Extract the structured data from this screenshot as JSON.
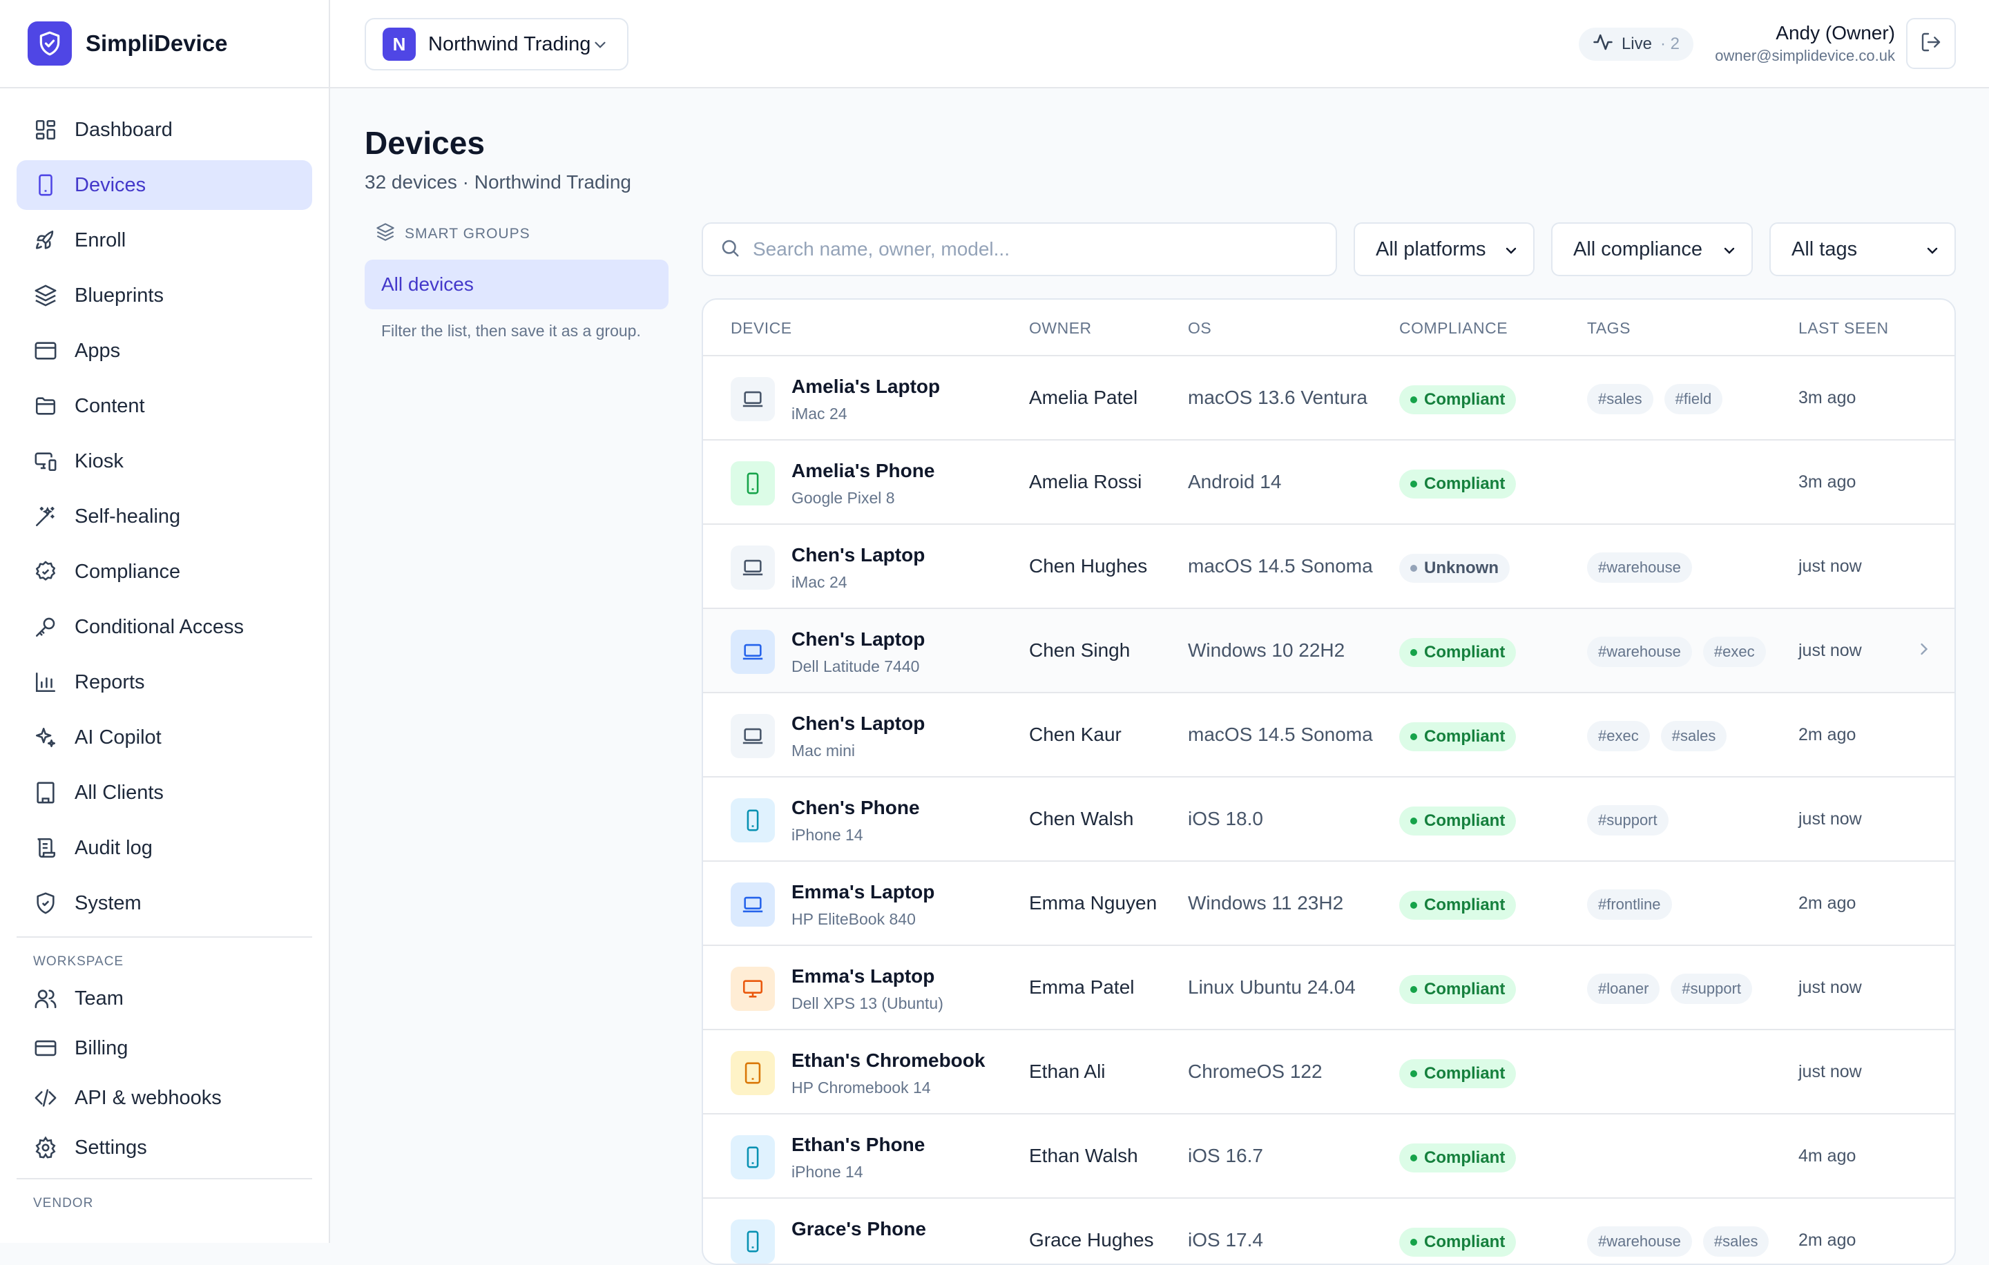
{
  "app": {
    "name": "SimpliDevice",
    "tenant": {
      "initial": "N",
      "name": "Northwind Trading"
    },
    "live": {
      "label": "Live",
      "count": "· 2"
    },
    "user": {
      "name": "Andy (Owner)",
      "email": "owner@simplidevice.co.uk"
    }
  },
  "sidebar": {
    "items": [
      {
        "label": "Dashboard"
      },
      {
        "label": "Devices"
      },
      {
        "label": "Enroll"
      },
      {
        "label": "Blueprints"
      },
      {
        "label": "Apps"
      },
      {
        "label": "Content"
      },
      {
        "label": "Kiosk"
      },
      {
        "label": "Self-healing"
      },
      {
        "label": "Compliance"
      },
      {
        "label": "Conditional Access"
      },
      {
        "label": "Reports"
      },
      {
        "label": "AI Copilot"
      },
      {
        "label": "All Clients"
      },
      {
        "label": "Audit log"
      },
      {
        "label": "System"
      }
    ],
    "workspace_label": "WORKSPACE",
    "workspace": [
      {
        "label": "Team"
      },
      {
        "label": "Billing"
      },
      {
        "label": "API & webhooks"
      },
      {
        "label": "Settings"
      }
    ],
    "vendor_label": "VENDOR"
  },
  "page": {
    "title": "Devices",
    "subtitle": "32 devices · Northwind Trading"
  },
  "groups": {
    "heading": "SMART GROUPS",
    "item": "All devices",
    "hint": "Filter the list, then save it as a group."
  },
  "filters": {
    "search_placeholder": "Search name, owner, model...",
    "platform": "All platforms",
    "compliance": "All compliance",
    "tags": "All tags"
  },
  "table": {
    "columns": [
      "DEVICE",
      "OWNER",
      "OS",
      "COMPLIANCE",
      "TAGS",
      "LAST SEEN"
    ],
    "rows": [
      {
        "name": "Amelia's Laptop",
        "model": "iMac 24",
        "owner": "Amelia Patel",
        "os": "macOS 13.6 Ventura",
        "compliance": "Compliant",
        "tags": [
          "#sales",
          "#field"
        ],
        "seen": "3m ago",
        "icon": "laptop-icon",
        "color": "#475569",
        "bg": "#f1f5f9"
      },
      {
        "name": "Amelia's Phone",
        "model": "Google Pixel 8",
        "owner": "Amelia Rossi",
        "os": "Android 14",
        "compliance": "Compliant",
        "tags": [],
        "seen": "3m ago",
        "icon": "phone-icon",
        "color": "#16a34a",
        "bg": "#dcfce7"
      },
      {
        "name": "Chen's Laptop",
        "model": "iMac 24",
        "owner": "Chen Hughes",
        "os": "macOS 14.5 Sonoma",
        "compliance": "Unknown",
        "tags": [
          "#warehouse"
        ],
        "seen": "just now",
        "icon": "laptop-icon",
        "color": "#475569",
        "bg": "#f1f5f9"
      },
      {
        "name": "Chen's Laptop",
        "model": "Dell Latitude 7440",
        "owner": "Chen Singh",
        "os": "Windows 10 22H2",
        "compliance": "Compliant",
        "tags": [
          "#warehouse",
          "#exec"
        ],
        "seen": "just now",
        "icon": "laptop-icon",
        "color": "#2563eb",
        "bg": "#dbeafe"
      },
      {
        "name": "Chen's Laptop",
        "model": "Mac mini",
        "owner": "Chen Kaur",
        "os": "macOS 14.5 Sonoma",
        "compliance": "Compliant",
        "tags": [
          "#exec",
          "#sales"
        ],
        "seen": "2m ago",
        "icon": "laptop-icon",
        "color": "#475569",
        "bg": "#f1f5f9"
      },
      {
        "name": "Chen's Phone",
        "model": "iPhone 14",
        "owner": "Chen Walsh",
        "os": "iOS 18.0",
        "compliance": "Compliant",
        "tags": [
          "#support"
        ],
        "seen": "just now",
        "icon": "phone-icon",
        "color": "#0891b2",
        "bg": "#e0f2fe"
      },
      {
        "name": "Emma's Laptop",
        "model": "HP EliteBook 840",
        "owner": "Emma Nguyen",
        "os": "Windows 11 23H2",
        "compliance": "Compliant",
        "tags": [
          "#frontline"
        ],
        "seen": "2m ago",
        "icon": "laptop-icon",
        "color": "#2563eb",
        "bg": "#dbeafe"
      },
      {
        "name": "Emma's Laptop",
        "model": "Dell XPS 13 (Ubuntu)",
        "owner": "Emma Patel",
        "os": "Linux Ubuntu 24.04",
        "compliance": "Compliant",
        "tags": [
          "#loaner",
          "#support"
        ],
        "seen": "just now",
        "icon": "monitor-icon",
        "color": "#ea580c",
        "bg": "#ffedd5"
      },
      {
        "name": "Ethan's Chromebook",
        "model": "HP Chromebook 14",
        "owner": "Ethan Ali",
        "os": "ChromeOS 122",
        "compliance": "Compliant",
        "tags": [],
        "seen": "just now",
        "icon": "tablet-icon",
        "color": "#d97706",
        "bg": "#fef3c7"
      },
      {
        "name": "Ethan's Phone",
        "model": "iPhone 14",
        "owner": "Ethan Walsh",
        "os": "iOS 16.7",
        "compliance": "Compliant",
        "tags": [],
        "seen": "4m ago",
        "icon": "phone-icon",
        "color": "#0891b2",
        "bg": "#e0f2fe"
      },
      {
        "name": "Grace's Phone",
        "model": "",
        "owner": "Grace Hughes",
        "os": "iOS 17.4",
        "compliance": "Compliant",
        "tags": [
          "#warehouse",
          "#sales"
        ],
        "seen": "2m ago",
        "icon": "phone-icon",
        "color": "#0891b2",
        "bg": "#e0f2fe"
      }
    ]
  },
  "colors": {
    "accent": "#4f46e5",
    "accent_soft": "#e0e7ff",
    "success": "#16a34a"
  }
}
